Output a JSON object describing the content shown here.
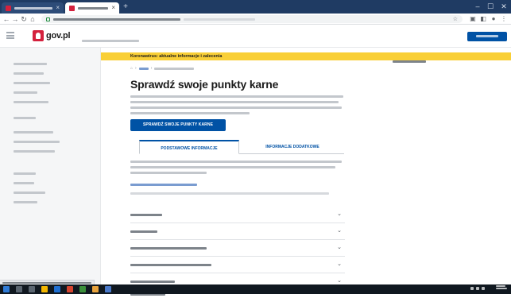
{
  "browser": {
    "tabs": [
      {
        "title": "",
        "active": false
      },
      {
        "title": "",
        "active": true
      }
    ],
    "omnibox_url": "",
    "window_controls": {
      "minimize": "–",
      "maximize": "☐",
      "close": "✕"
    }
  },
  "header": {
    "logo_text": "gov.pl",
    "search_hint": "",
    "login_label": ""
  },
  "sidebar": {
    "items": [
      {
        "label": ""
      },
      {
        "label": ""
      },
      {
        "label": ""
      },
      {
        "label": ""
      },
      {
        "label": ""
      },
      {
        "label": ""
      },
      {
        "label": ""
      },
      {
        "label": ""
      },
      {
        "label": ""
      },
      {
        "label": ""
      },
      {
        "label": ""
      },
      {
        "label": ""
      }
    ]
  },
  "banner": {
    "text": "Koronawirus: aktualne informacje i zalecenia",
    "link_label": ""
  },
  "main": {
    "breadcrumb": [
      "",
      ""
    ],
    "title": "Sprawdź swoje punkty karne",
    "cta_label": "SPRAWDŹ SWOJE PUNKTY KARNE",
    "tabs": [
      {
        "label": "PODSTAWOWE INFORMACJE",
        "active": true
      },
      {
        "label": "INFORMACJE DODATKOWE",
        "active": false
      }
    ],
    "guide_link": "",
    "accordion": [
      {
        "label": ""
      },
      {
        "label": ""
      },
      {
        "label": ""
      },
      {
        "label": ""
      },
      {
        "label": ""
      },
      {
        "label": ""
      }
    ]
  },
  "colors": {
    "accent": "#0052a5",
    "banner": "#f9cf36",
    "logo": "#d4213d",
    "tabstrip": "#1f3b63"
  }
}
